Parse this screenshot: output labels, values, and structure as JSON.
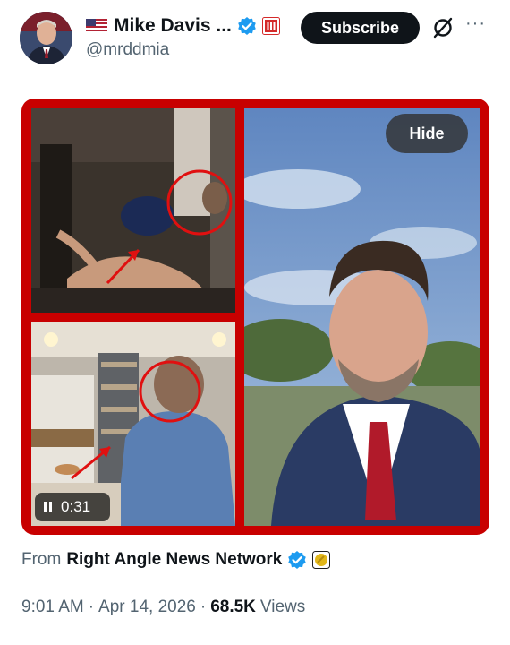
{
  "author": {
    "display_name": "Mike Davis ...",
    "handle": "@mrddmia"
  },
  "header": {
    "subscribe_label": "Subscribe",
    "more_label": "···"
  },
  "media": {
    "hide_label": "Hide",
    "video_time": "0:31"
  },
  "source": {
    "prefix": "From",
    "org_name": "Right Angle News Network"
  },
  "meta": {
    "time": "9:01 AM",
    "date": "Apr 14, 2026",
    "views_count": "68.5K",
    "views_label": "Views",
    "separator": "·"
  },
  "colors": {
    "verified_blue": "#1d9bf0",
    "affiliation_red": "#d42a2a",
    "gold_badge": "#e2b719",
    "frame_red": "#c80000"
  },
  "icons": [
    "us-flag-icon",
    "verified-badge-icon",
    "affiliation-badge-icon",
    "grok-icon",
    "more-icon",
    "pause-icon",
    "gold-badge-icon"
  ]
}
